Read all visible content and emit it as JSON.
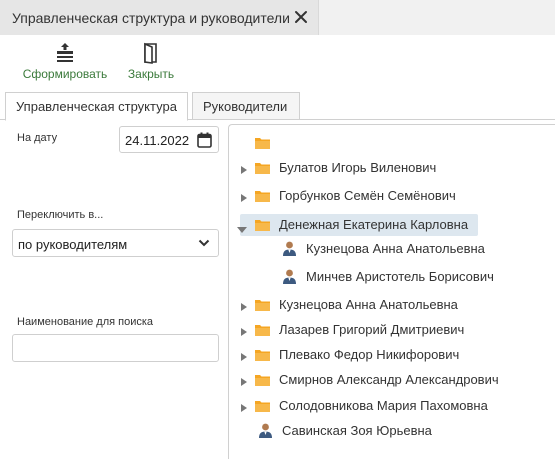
{
  "window": {
    "tab_title": "Управленческая структура и руководители"
  },
  "toolbar": {
    "form_label": "Сформировать",
    "close_label": "Закрыть"
  },
  "tabs": [
    {
      "label": "Управленческая структура",
      "active": true
    },
    {
      "label": "Руководители",
      "active": false
    }
  ],
  "filters": {
    "date_label": "На дату",
    "date_value": "24.11.2022",
    "switch_label": "Переключить в...",
    "switch_value": "по руководителям",
    "search_label": "Наименование для поиска",
    "search_value": ""
  },
  "tree": [
    {
      "label": "",
      "icon": "folder-icon",
      "expander": "none",
      "level": 0
    },
    {
      "label": "Булатов Игорь Виленович",
      "icon": "folder-icon",
      "expander": "collapsed",
      "level": 0
    },
    {
      "label": "Горбунков Семён Семёнович",
      "icon": "folder-icon",
      "expander": "collapsed",
      "level": 0
    },
    {
      "label": "Денежная Екатерина Карловна",
      "icon": "folder-icon",
      "expander": "expanded",
      "level": 0,
      "selected": true
    },
    {
      "label": "Кузнецова Анна Анатольевна",
      "icon": "person-icon",
      "expander": "none",
      "level": 1
    },
    {
      "label": "Минчев Аристотель Борисович",
      "icon": "person-icon",
      "expander": "none",
      "level": 1
    },
    {
      "label": "Кузнецова Анна Анатольевна",
      "icon": "folder-icon",
      "expander": "collapsed",
      "level": 0
    },
    {
      "label": "Лазарев Григорий Дмитриевич",
      "icon": "folder-icon",
      "expander": "collapsed",
      "level": 0
    },
    {
      "label": "Плевако Федор Никифорович",
      "icon": "folder-icon",
      "expander": "collapsed",
      "level": 0
    },
    {
      "label": "Смирнов Александр Александрович",
      "icon": "folder-icon",
      "expander": "collapsed",
      "level": 0
    },
    {
      "label": "Солодовникова Мария Пахомовна",
      "icon": "folder-icon",
      "expander": "collapsed",
      "level": 0
    },
    {
      "label": "Савинская Зоя Юрьевна",
      "icon": "person-icon",
      "expander": "none",
      "level": 0
    }
  ],
  "colors": {
    "accent_green": "#3b7a3b",
    "folder": "#f5a623",
    "selection": "#dde7ef"
  }
}
